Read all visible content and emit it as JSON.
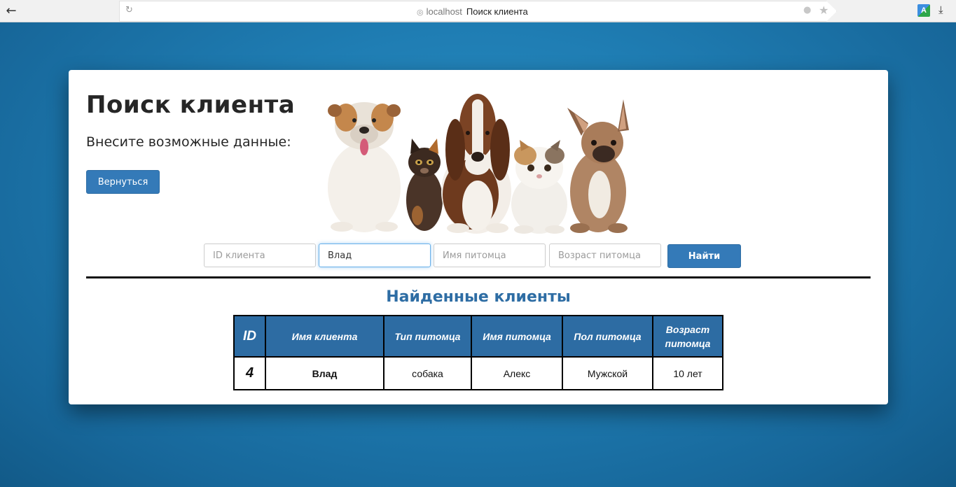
{
  "browser": {
    "host": "localhost",
    "page_title": "Поиск клиента"
  },
  "page": {
    "title": "Поиск клиента",
    "subtitle": "Внесите возможные данные:",
    "back_button": "Вернуться"
  },
  "search": {
    "id_placeholder": "ID клиента",
    "name_value": "Влад",
    "pet_name_placeholder": "Имя питомца",
    "pet_age_placeholder": "Возраст питомца",
    "find_button": "Найти"
  },
  "results": {
    "title": "Найденные клиенты",
    "headers": [
      "ID",
      "Имя клиента",
      "Тип питомца",
      "Имя питомца",
      "Пол питомца",
      "Возраст питомца"
    ],
    "rows": [
      [
        "4",
        "Влад",
        "собака",
        "Алекс",
        "Мужской",
        "10 лет"
      ]
    ]
  },
  "colors": {
    "accent": "#347ab8",
    "table_header": "#2d6ca3",
    "background": "#1f7db3"
  }
}
